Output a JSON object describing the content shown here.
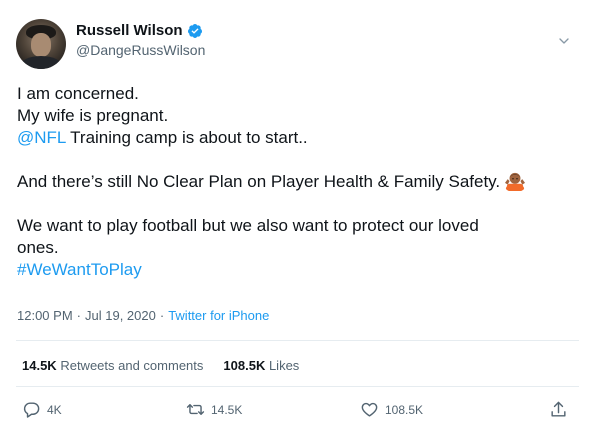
{
  "author": {
    "display_name": "Russell Wilson",
    "handle": "@DangeRussWilson",
    "verified": true
  },
  "tweet": {
    "line1": "I am concerned.",
    "line2": "My wife is pregnant.",
    "mention": "@NFL",
    "line3_rest": " Training camp is about to start..",
    "line4": "And there’s still No Clear Plan on Player Health & Family Safety.",
    "line5": "We want to play football but we also want to protect our loved",
    "line6": "ones.",
    "hashtag": "#WeWantToPlay"
  },
  "meta": {
    "time": "12:00 PM",
    "separator1": "·",
    "date": "Jul 19, 2020",
    "separator2": "·",
    "source": "Twitter for iPhone"
  },
  "stats": {
    "retweets_count": "14.5K",
    "retweets_label": "Retweets and comments",
    "likes_count": "108.5K",
    "likes_label": "Likes"
  },
  "actions": {
    "reply_count": "4K",
    "retweet_count": "14.5K",
    "like_count": "108.5K"
  },
  "colors": {
    "link": "#1d9bf0",
    "verified": "#1d9bf0",
    "secondary_text": "#536471"
  }
}
